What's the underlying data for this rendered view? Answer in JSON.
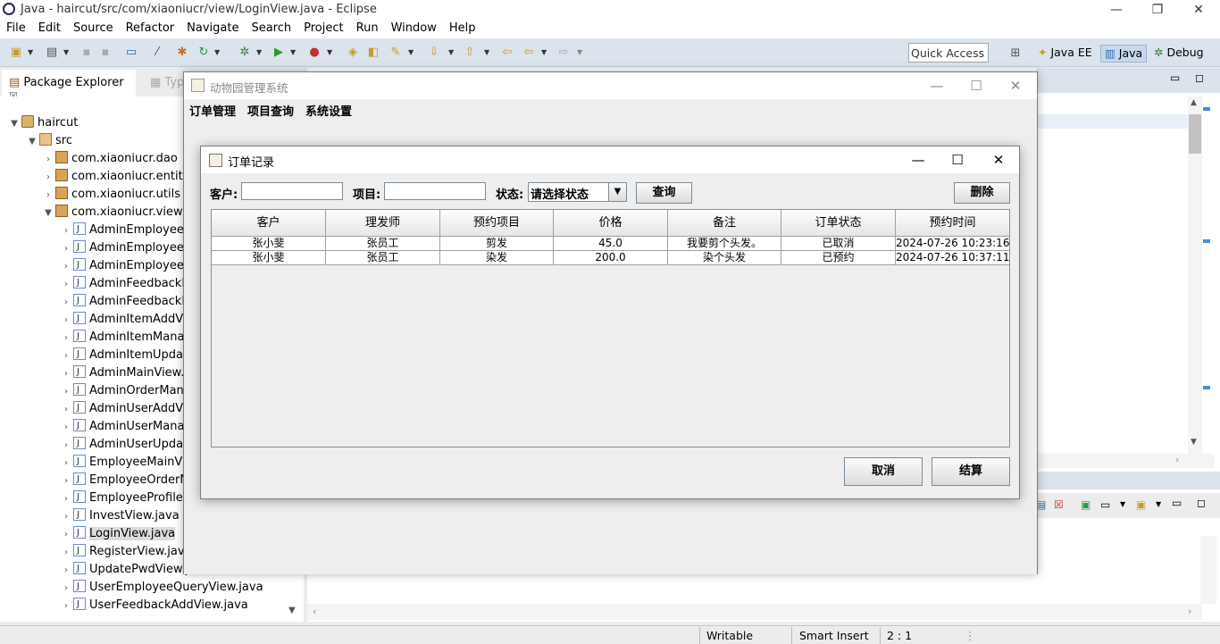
{
  "eclipse": {
    "title": "Java - haircut/src/com/xiaoniucr/view/LoginView.java - Eclipse",
    "menu": [
      "File",
      "Edit",
      "Source",
      "Refactor",
      "Navigate",
      "Search",
      "Project",
      "Run",
      "Window",
      "Help"
    ],
    "quick_access": "Quick Access",
    "perspectives": [
      "Java EE",
      "Java",
      "Debug"
    ],
    "active_perspective": "Java",
    "explorer_tab": "Package Explorer",
    "explorer_tab2": "Type",
    "tree": {
      "project": "haircut",
      "src": "src",
      "packages": [
        "com.xiaoniucr.dao",
        "com.xiaoniucr.entity",
        "com.xiaoniucr.utils",
        "com.xiaoniucr.view"
      ],
      "files": [
        "AdminEmployeeA",
        "AdminEmployeeM",
        "AdminEmployeeU",
        "AdminFeedbackM",
        "AdminFeedbackR",
        "AdminItemAddVi",
        "AdminItemManag",
        "AdminItemUpdat",
        "AdminMainView.j",
        "AdminOrderMana",
        "AdminUserAddVi",
        "AdminUserManag",
        "AdminUserUpdat",
        "EmployeeMainVie",
        "EmployeeOrderM",
        "EmployeeProfileV",
        "InvestView.java",
        "LoginView.java",
        "RegisterView.java",
        "UpdatePwdView.java",
        "UserEmployeeQueryView.java",
        "UserFeedbackAddView.java"
      ],
      "selected": "LoginView.java"
    },
    "status": {
      "writable": "Writable",
      "insert": "Smart Insert",
      "position": "2 : 1"
    }
  },
  "main_window": {
    "title": "动物园管理系统",
    "menu": [
      "订单管理",
      "项目查询",
      "系统设置"
    ]
  },
  "dialog": {
    "title": "订单记录",
    "customer_label": "客户:",
    "customer_value": "",
    "item_label": "项目:",
    "item_value": "",
    "status_label": "状态:",
    "status_selected": "请选择状态",
    "query_button": "查询",
    "delete_button": "删除",
    "cancel_button": "取消",
    "settle_button": "结算",
    "table": {
      "columns": [
        "客户",
        "理发师",
        "预约项目",
        "价格",
        "备注",
        "订单状态",
        "预约时间"
      ],
      "rows": [
        [
          "张小斐",
          "张员工",
          "剪发",
          "45.0",
          "我要剪个头发。",
          "已取消",
          "2024-07-26 10:23:16"
        ],
        [
          "张小斐",
          "张员工",
          "染发",
          "200.0",
          "染个头发",
          "已预约",
          "2024-07-26 10:37:11"
        ]
      ]
    }
  }
}
